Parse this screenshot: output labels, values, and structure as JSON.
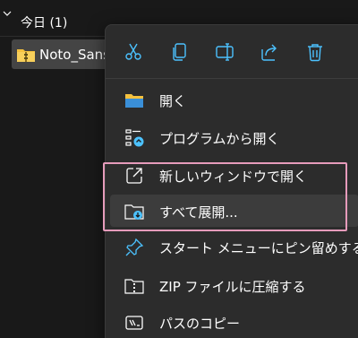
{
  "group": {
    "label": "今日 (1)"
  },
  "file": {
    "name": "Noto_Sans_"
  },
  "action_bar": {
    "buttons": [
      {
        "name": "cut"
      },
      {
        "name": "copy"
      },
      {
        "name": "rename"
      },
      {
        "name": "share"
      },
      {
        "name": "delete"
      }
    ]
  },
  "menu": {
    "items": [
      {
        "label": "開く",
        "icon": "folder-icon"
      },
      {
        "label": "プログラムから開く",
        "icon": "open-with-icon"
      },
      {
        "label": "新しいウィンドウで開く",
        "icon": "new-window-icon"
      },
      {
        "label": "すべて展開...",
        "icon": "extract-all-icon"
      },
      {
        "label": "スタート メニューにピン留めする",
        "icon": "pin-icon"
      },
      {
        "label": "ZIP ファイルに圧縮する",
        "icon": "zip-icon"
      },
      {
        "label": "パスのコピー",
        "icon": "copy-path-icon"
      }
    ]
  },
  "colors": {
    "accent": "#4cc2ff",
    "highlight": "#e69bbb",
    "folder": "#f5c13e"
  }
}
